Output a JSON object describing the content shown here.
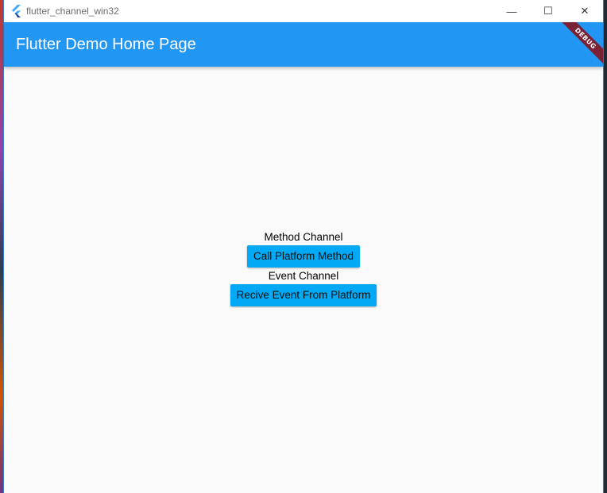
{
  "window": {
    "title": "flutter_channel_win32",
    "controls": {
      "minimize": "—",
      "maximize": "☐",
      "close": "✕"
    }
  },
  "appbar": {
    "title": "Flutter Demo Home Page",
    "debug_banner": "DEBUG"
  },
  "main": {
    "method_label": "Method Channel",
    "method_button": "Call Platform Method",
    "event_label": "Event Channel",
    "event_button": "Recive Event From Platform"
  },
  "colors": {
    "appbar": "#2196f3",
    "button": "#03a9f4",
    "debug": "#7a2235"
  }
}
